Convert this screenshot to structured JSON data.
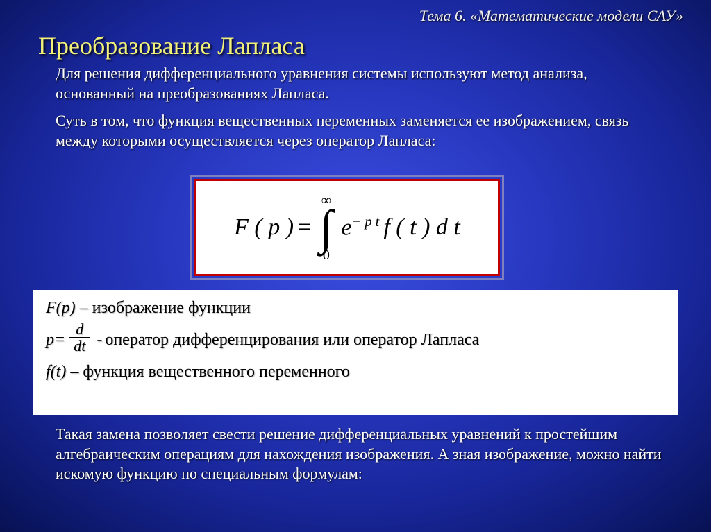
{
  "topic": "Тема 6. «Математические модели САУ»",
  "title": "Преобразование Лапласа",
  "para1": "Для решения дифференциального уравнения системы используют метод анализа, основанный на преобразованиях Лапласа.",
  "para2": "Суть в том, что функция вещественных переменных заменяется ее изображением, связь между которыми осуществляется через оператор Лапласа:",
  "formula": {
    "lhs": "F ( p )",
    "eq": "=",
    "int_upper": "∞",
    "int_lower": "0",
    "epart_e": "e",
    "epart_sup": "− p t",
    "fpart": "f ( t ) d t"
  },
  "defs": {
    "line1_lhs": "F(p)",
    "line1_rest": " – изображение функции",
    "line2_lhs": "p=",
    "frac_num": "d",
    "frac_den": "dt",
    "line2_sep": "-",
    "line2_rest": "оператор дифференцирования или оператор Лапласа",
    "line3_lhs": "f(t)",
    "line3_rest": " – функция вещественного переменного"
  },
  "para3": "Такая замена позволяет свести решение дифференциальных уравнений к простейшим алгебраическим операциям для нахождения изображения. А зная изображение, можно найти искомую функцию по специальным формулам:"
}
